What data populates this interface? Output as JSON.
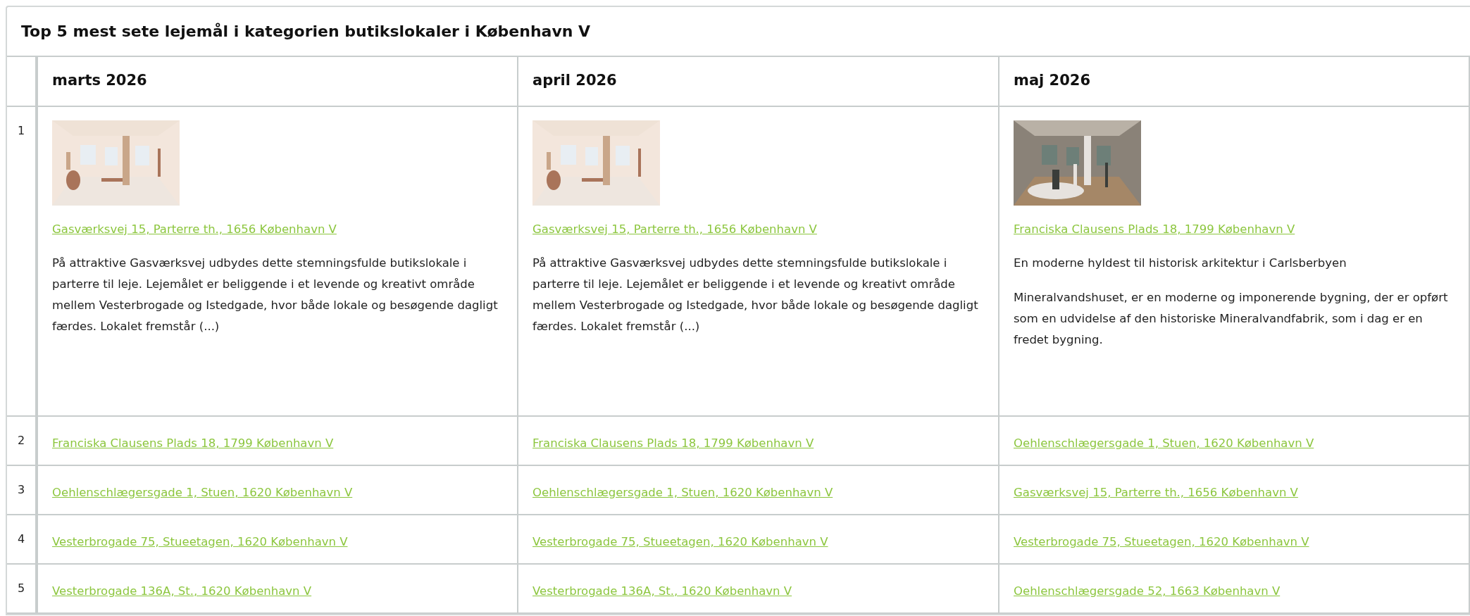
{
  "title": "Top 5 mest sete lejemål i kategorien butikslokaler i København V",
  "columns": [
    {
      "label": "marts 2026"
    },
    {
      "label": "april 2026"
    },
    {
      "label": "maj 2026"
    }
  ],
  "rows": [
    {
      "rank": "1",
      "cells": [
        {
          "kind": "featured",
          "image": {
            "kind": "picture"
          },
          "address": "Gasværksvej 15, Parterre th., 1656 København V",
          "paragraphs": [
            "På attraktive Gasværksvej udbydes dette stemningsfulde butikslokale i parterre til leje. Lejemålet er beliggende i et levende og kreativt område mellem Vesterbrogade og Istedgade, hvor både lokale og besøgende dagligt færdes. Lokalet fremstår (...)"
          ]
        },
        {
          "kind": "featured",
          "image": {
            "kind": "picture"
          },
          "address": "Gasværksvej 15, Parterre th., 1656 København V",
          "paragraphs": [
            "På attraktive Gasværksvej udbydes dette stemningsfulde butikslokale i parterre til leje. Lejemålet er beliggende i et levende og kreativt område mellem Vesterbrogade og Istedgade, hvor både lokale og besøgende dagligt færdes. Lokalet fremstår (...)"
          ]
        },
        {
          "kind": "featured",
          "image": {
            "kind": "picture"
          },
          "address": "Franciska Clausens Plads 18, 1799 København V",
          "paragraphs": [
            "En moderne hyldest til historisk arkitektur i Carlsberbyen",
            "Mineralvandshuset, er en moderne og imponerende bygning, der er opført som en udvidelse af den historiske Mineralvandfabrik, som i dag er en fredet bygning."
          ]
        }
      ]
    },
    {
      "rank": "2",
      "cells": [
        {
          "kind": "link",
          "address": "Franciska Clausens Plads 18, 1799 København V"
        },
        {
          "kind": "link",
          "address": "Franciska Clausens Plads 18, 1799 København V"
        },
        {
          "kind": "link",
          "address": "Oehlenschlægersgade 1, Stuen, 1620 København V"
        }
      ]
    },
    {
      "rank": "3",
      "cells": [
        {
          "kind": "link",
          "address": "Oehlenschlægersgade 1, Stuen, 1620 København V"
        },
        {
          "kind": "link",
          "address": "Oehlenschlægersgade 1, Stuen, 1620 København V"
        },
        {
          "kind": "link",
          "address": "Gasværksvej 15, Parterre th., 1656 København V"
        }
      ]
    },
    {
      "rank": "4",
      "cells": [
        {
          "kind": "link",
          "address": "Vesterbrogade 75, Stueetagen, 1620 København V"
        },
        {
          "kind": "link",
          "address": "Vesterbrogade 75, Stueetagen, 1620 København V"
        },
        {
          "kind": "link",
          "address": "Vesterbrogade 75, Stueetagen, 1620 København V"
        }
      ]
    },
    {
      "rank": "5",
      "cells": [
        {
          "kind": "link",
          "address": "Vesterbrogade 136A, St., 1620 København V"
        },
        {
          "kind": "link",
          "address": "Vesterbrogade 136A, St., 1620 København V"
        },
        {
          "kind": "link",
          "address": "Oehlenschlægersgade 52, 1663 København V"
        }
      ]
    }
  ]
}
